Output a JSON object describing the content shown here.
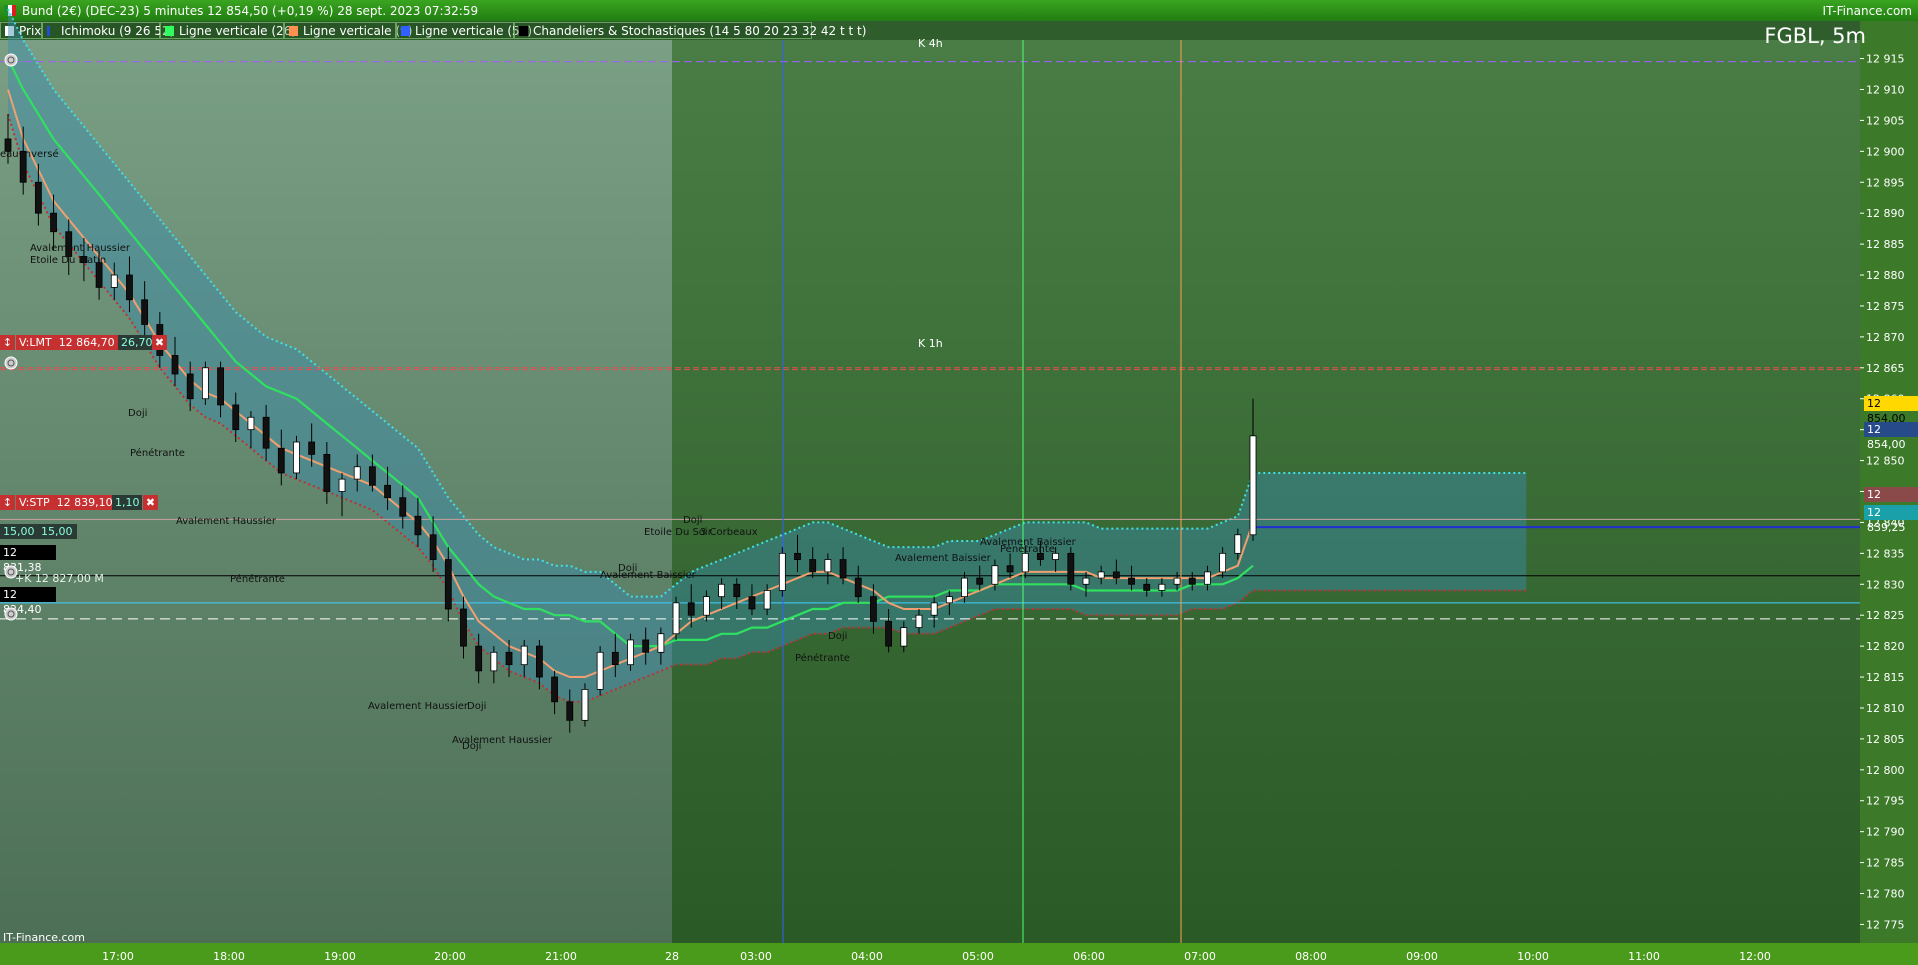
{
  "window": {
    "title": "Bund (2€) (DEC-23) 5 minutes 12 854,50 (+0,19 %) 28 sept. 2023 07:32:59",
    "brand": "IT-Finance.com"
  },
  "legend": [
    {
      "label": "Prix",
      "color": "#ffffff"
    },
    {
      "label": "Ichimoku (9 26 52)",
      "color": "#2050d0"
    },
    {
      "label": "Ligne verticale (26)",
      "color": "#30ff60"
    },
    {
      "label": "Ligne verticale (9)",
      "color": "#ff9050"
    },
    {
      "label": "Ligne verticale (52)",
      "color": "#3060ff"
    },
    {
      "label": "Chandeliers & Stochastiques (14 5 80 20 23 32 42 t t t)",
      "color": "#000000"
    }
  ],
  "symbol": "FGBL, 5m",
  "watermark": "IT-Finance.com",
  "levels": {
    "k4h": "K 4h",
    "k1h": "K 1h"
  },
  "orders": {
    "lmt": {
      "label": "V:LMT",
      "price": "12 864,70",
      "qty": "26,70"
    },
    "stp": {
      "label": "V:STP",
      "price": "12 839,10",
      "qty": "1,10"
    },
    "qty1": "15,00",
    "qty2": "15,00",
    "price_a": "12 831,38",
    "line_a": "+K 12 827,00 M",
    "price_b": "12 824,40"
  },
  "price_tags": {
    "last": "12 854,00",
    "blue": "12 854,00",
    "red": "12 843,00",
    "cyan": "12 839,25"
  },
  "patterns": [
    {
      "t": "eau Inversé",
      "x": 0,
      "y": 149
    },
    {
      "t": "Avalement Haussier",
      "x": 30,
      "y": 243
    },
    {
      "t": "Etoile Du Matin",
      "x": 30,
      "y": 255
    },
    {
      "t": "Doji",
      "x": 128,
      "y": 408
    },
    {
      "t": "Pénétrante",
      "x": 130,
      "y": 448
    },
    {
      "t": "Avalement Haussier",
      "x": 176,
      "y": 516
    },
    {
      "t": "Pénétrante",
      "x": 230,
      "y": 574
    },
    {
      "t": "Avalement Haussier",
      "x": 368,
      "y": 701
    },
    {
      "t": "Doji",
      "x": 467,
      "y": 701
    },
    {
      "t": "Avalement Haussier",
      "x": 452,
      "y": 735
    },
    {
      "t": "Doji",
      "x": 462,
      "y": 741
    },
    {
      "t": "Doji",
      "x": 618,
      "y": 563
    },
    {
      "t": "Avalement Baissier",
      "x": 600,
      "y": 570
    },
    {
      "t": "Etoile Du Soir",
      "x": 644,
      "y": 527
    },
    {
      "t": "Doji",
      "x": 683,
      "y": 515
    },
    {
      "t": "3 Corbeaux",
      "x": 700,
      "y": 527
    },
    {
      "t": "Pénétrante",
      "x": 795,
      "y": 653
    },
    {
      "t": "Doji",
      "x": 828,
      "y": 631
    },
    {
      "t": "Avalement Baissier",
      "x": 895,
      "y": 553
    },
    {
      "t": "Avalement Baissier",
      "x": 980,
      "y": 537
    },
    {
      "t": "Pénétrante",
      "x": 1000,
      "y": 544
    }
  ],
  "chart_data": {
    "type": "candlestick",
    "title": "FGBL, 5m",
    "ylim": [
      12772,
      12918
    ],
    "y_ticks": [
      12775,
      12780,
      12785,
      12790,
      12795,
      12800,
      12805,
      12810,
      12815,
      12820,
      12825,
      12830,
      12835,
      12840,
      12845,
      12850,
      12855,
      12860,
      12865,
      12870,
      12875,
      12880,
      12885,
      12890,
      12895,
      12900,
      12905,
      12910,
      12915
    ],
    "y_tick_labels": [
      "12 775",
      "12 780",
      "12 785",
      "12 790",
      "12 795",
      "12 800",
      "12 805",
      "12 810",
      "12 815",
      "12 820",
      "12 825",
      "12 830",
      "12 835",
      "12 840",
      "12 845",
      "12 850",
      "12 855",
      "12 860",
      "12 865",
      "12 870",
      "12 875",
      "12 880",
      "12 885",
      "12 890",
      "12 895",
      "12 900",
      "12 905",
      "12 910",
      "12 915"
    ],
    "x_ticks": [
      "17:00",
      "18:00",
      "19:00",
      "20:00",
      "21:00",
      "28",
      "03:00",
      "04:00",
      "05:00",
      "06:00",
      "07:00",
      "08:00",
      "09:00",
      "10:00",
      "11:00",
      "12:00"
    ],
    "horizontal_levels": [
      {
        "name": "K 4h",
        "value": 12914.5
      },
      {
        "name": "K 1h",
        "value": 12865.0
      },
      {
        "name": "V:STP",
        "value": 12840.5
      },
      {
        "name": "V:LMT",
        "value": 12864.7
      },
      {
        "name": "cyan",
        "value": 12839.25
      },
      {
        "name": "black",
        "value": 12831.38
      },
      {
        "name": "cyan2",
        "value": 12827.0
      },
      {
        "name": "dash",
        "value": 12824.4
      }
    ],
    "candles": [
      [
        12902,
        12906,
        12898,
        12900
      ],
      [
        12900,
        12904,
        12893,
        12895
      ],
      [
        12895,
        12898,
        12888,
        12890
      ],
      [
        12890,
        12893,
        12884,
        12887
      ],
      [
        12887,
        12889,
        12880,
        12883
      ],
      [
        12883,
        12886,
        12879,
        12882
      ],
      [
        12882,
        12884,
        12876,
        12878
      ],
      [
        12878,
        12882,
        12876,
        12880
      ],
      [
        12880,
        12883,
        12874,
        12876
      ],
      [
        12876,
        12879,
        12870,
        12872
      ],
      [
        12872,
        12874,
        12865,
        12867
      ],
      [
        12867,
        12870,
        12862,
        12864
      ],
      [
        12864,
        12866,
        12858,
        12860
      ],
      [
        12860,
        12866,
        12859,
        12865
      ],
      [
        12865,
        12866,
        12857,
        12859
      ],
      [
        12859,
        12861,
        12853,
        12855
      ],
      [
        12855,
        12858,
        12852,
        12857
      ],
      [
        12857,
        12859,
        12850,
        12852
      ],
      [
        12852,
        12855,
        12846,
        12848
      ],
      [
        12848,
        12854,
        12847,
        12853
      ],
      [
        12853,
        12856,
        12849,
        12851
      ],
      [
        12851,
        12853,
        12843,
        12845
      ],
      [
        12845,
        12848,
        12841,
        12847
      ],
      [
        12847,
        12851,
        12845,
        12849
      ],
      [
        12849,
        12851,
        12845,
        12846
      ],
      [
        12846,
        12849,
        12842,
        12844
      ],
      [
        12844,
        12846,
        12839,
        12841
      ],
      [
        12841,
        12844,
        12836,
        12838
      ],
      [
        12838,
        12841,
        12832,
        12834
      ],
      [
        12834,
        12836,
        12824,
        12826
      ],
      [
        12826,
        12828,
        12818,
        12820
      ],
      [
        12820,
        12822,
        12814,
        12816
      ],
      [
        12816,
        12820,
        12814,
        12819
      ],
      [
        12819,
        12821,
        12815,
        12817
      ],
      [
        12817,
        12821,
        12815,
        12820
      ],
      [
        12820,
        12821,
        12813,
        12815
      ],
      [
        12815,
        12816,
        12809,
        12811
      ],
      [
        12811,
        12813,
        12806,
        12808
      ],
      [
        12808,
        12814,
        12807,
        12813
      ],
      [
        12813,
        12820,
        12812,
        12819
      ],
      [
        12819,
        12822,
        12815,
        12817
      ],
      [
        12817,
        12822,
        12816,
        12821
      ],
      [
        12821,
        12823,
        12817,
        12819
      ],
      [
        12819,
        12823,
        12817,
        12822
      ],
      [
        12822,
        12828,
        12821,
        12827
      ],
      [
        12827,
        12830,
        12823,
        12825
      ],
      [
        12825,
        12829,
        12824,
        12828
      ],
      [
        12828,
        12831,
        12826,
        12830
      ],
      [
        12830,
        12831,
        12826,
        12828
      ],
      [
        12828,
        12830,
        12825,
        12826
      ],
      [
        12826,
        12830,
        12825,
        12829
      ],
      [
        12829,
        12836,
        12828,
        12835
      ],
      [
        12835,
        12838,
        12832,
        12834
      ],
      [
        12834,
        12836,
        12831,
        12832
      ],
      [
        12832,
        12835,
        12830,
        12834
      ],
      [
        12834,
        12836,
        12830,
        12831
      ],
      [
        12831,
        12833,
        12827,
        12828
      ],
      [
        12828,
        12830,
        12822,
        12824
      ],
      [
        12824,
        12826,
        12819,
        12820
      ],
      [
        12820,
        12824,
        12819,
        12823
      ],
      [
        12823,
        12826,
        12822,
        12825
      ],
      [
        12825,
        12828,
        12823,
        12827
      ],
      [
        12827,
        12829,
        12825,
        12828
      ],
      [
        12828,
        12832,
        12827,
        12831
      ],
      [
        12831,
        12833,
        12829,
        12830
      ],
      [
        12830,
        12834,
        12829,
        12833
      ],
      [
        12833,
        12835,
        12831,
        12832
      ],
      [
        12832,
        12836,
        12831,
        12835
      ],
      [
        12835,
        12837,
        12833,
        12834
      ],
      [
        12834,
        12836,
        12832,
        12835
      ],
      [
        12835,
        12836,
        12829,
        12830
      ],
      [
        12830,
        12832,
        12828,
        12831
      ],
      [
        12831,
        12833,
        12830,
        12832
      ],
      [
        12832,
        12834,
        12830,
        12831
      ],
      [
        12831,
        12833,
        12829,
        12830
      ],
      [
        12830,
        12831,
        12828,
        12829
      ],
      [
        12829,
        12831,
        12828,
        12830
      ],
      [
        12830,
        12832,
        12829,
        12831
      ],
      [
        12831,
        12832,
        12829,
        12830
      ],
      [
        12830,
        12833,
        12829,
        12832
      ],
      [
        12832,
        12836,
        12831,
        12835
      ],
      [
        12835,
        12839,
        12834,
        12838
      ],
      [
        12838,
        12860,
        12837,
        12854
      ]
    ],
    "tenkan": [
      12910,
      12902,
      12897,
      12892,
      12889,
      12886,
      12883,
      12880,
      12877,
      12873,
      12869,
      12866,
      12863,
      12861,
      12860,
      12858,
      12856,
      12854,
      12852,
      12851,
      12850,
      12849,
      12848,
      12847,
      12846,
      12844,
      12842,
      12840,
      12837,
      12833,
      12828,
      12824,
      12822,
      12820,
      12819,
      12818,
      12816,
      12815,
      12815,
      12816,
      12817,
      12818,
      12819,
      12820,
      12822,
      12824,
      12825,
      12826,
      12827,
      12828,
      12829,
      12830,
      12831,
      12832,
      12832,
      12831,
      12830,
      12829,
      12827,
      12826,
      12826,
      12826,
      12827,
      12828,
      12829,
      12830,
      12831,
      12832,
      12832,
      12832,
      12832,
      12832,
      12831,
      12831,
      12831,
      12831,
      12831,
      12831,
      12831,
      12831,
      12832,
      12833,
      12840
    ],
    "kijun": [
      12915,
      12910,
      12906,
      12902,
      12899,
      12896,
      12893,
      12890,
      12887,
      12884,
      12881,
      12878,
      12875,
      12872,
      12869,
      12866,
      12864,
      12862,
      12861,
      12860,
      12858,
      12856,
      12854,
      12852,
      12850,
      12848,
      12846,
      12844,
      12840,
      12836,
      12833,
      12830,
      12828,
      12827,
      12826,
      12826,
      12825,
      12825,
      12824,
      12824,
      12822,
      12820,
      12820,
      12820,
      12821,
      12821,
      12821,
      12822,
      12822,
      12823,
      12823,
      12824,
      12825,
      12826,
      12826,
      12827,
      12827,
      12827,
      12828,
      12828,
      12828,
      12828,
      12829,
      12829,
      12829,
      12830,
      12830,
      12830,
      12830,
      12830,
      12830,
      12829,
      12829,
      12829,
      12829,
      12829,
      12829,
      12829,
      12830,
      12830,
      12830,
      12831,
      12833
    ]
  }
}
